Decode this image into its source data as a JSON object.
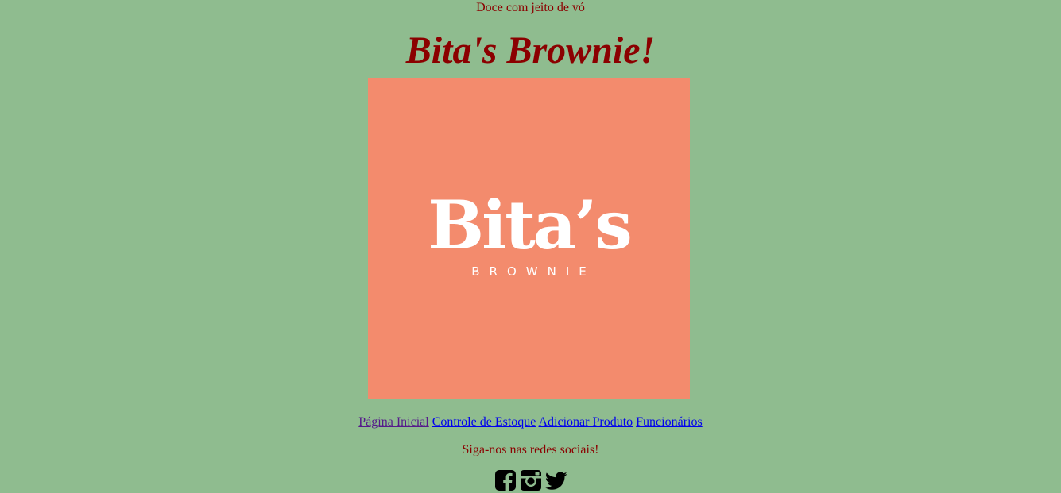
{
  "header": {
    "tagline": "Doce com jeito de vó",
    "title": "Bita's Brownie!"
  },
  "logo": {
    "name": "Bita’s",
    "subtitle": "BROWNIE",
    "background": "#f38b6d"
  },
  "nav": {
    "items": [
      {
        "label": "Página Inicial",
        "visited": true
      },
      {
        "label": "Controle de Estoque",
        "visited": false
      },
      {
        "label": "Adicionar Produto",
        "visited": false
      },
      {
        "label": "Funcionários",
        "visited": false
      }
    ]
  },
  "social": {
    "heading": "Siga-nos nas redes sociais!",
    "icons": [
      "facebook-icon",
      "instagram-icon",
      "twitter-icon"
    ]
  },
  "colors": {
    "background": "#8fbc8f",
    "text": "#8b0000",
    "link": "#0000ee",
    "visited_link": "#551a8b"
  }
}
